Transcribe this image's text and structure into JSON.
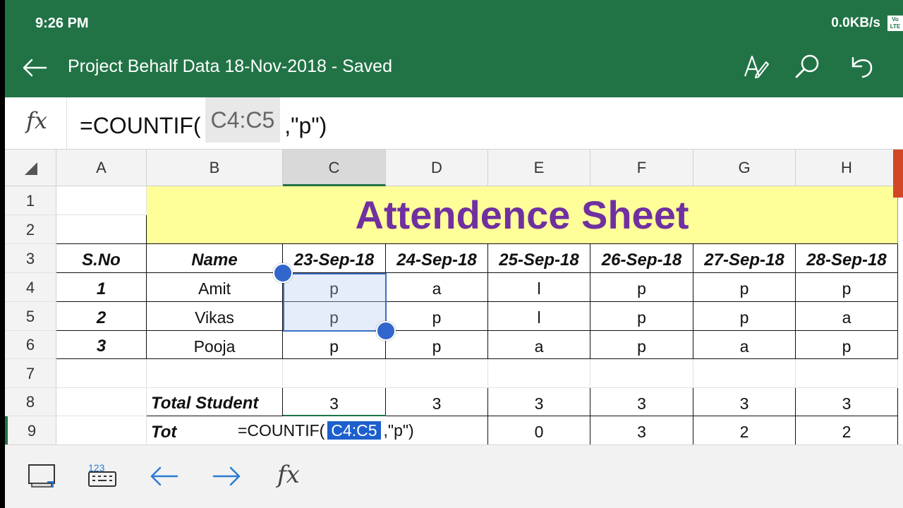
{
  "status": {
    "time": "9:26 PM",
    "network": "0.0KB/s",
    "lte_badge": "Vo LTE"
  },
  "titlebar": {
    "title": "Project Behalf Data 18-Nov-2018 - Saved"
  },
  "formula_bar": {
    "fx": "fx",
    "prefix": "=COUNTIF(",
    "ref": "C4:C5",
    "suffix": ",\"p\")"
  },
  "columns": [
    "A",
    "B",
    "C",
    "D",
    "E",
    "F",
    "G",
    "H"
  ],
  "rows": [
    "1",
    "2",
    "3",
    "4",
    "5",
    "6",
    "7",
    "8",
    "9"
  ],
  "sheet": {
    "banner": "Attendence Sheet",
    "headers": [
      "S.No",
      "Name",
      "23-Sep-18",
      "24-Sep-18",
      "25-Sep-18",
      "26-Sep-18",
      "27-Sep-18",
      "28-Sep-18"
    ],
    "records": [
      [
        "1",
        "Amit",
        "p",
        "a",
        "l",
        "p",
        "p",
        "p"
      ],
      [
        "2",
        "Vikas",
        "p",
        "p",
        "l",
        "p",
        "p",
        "a"
      ],
      [
        "3",
        "Pooja",
        "p",
        "p",
        "a",
        "p",
        "a",
        "p"
      ]
    ],
    "total_student": {
      "label": "Total Student",
      "values": [
        "3",
        "3",
        "3",
        "3",
        "3",
        "3"
      ]
    },
    "row9": {
      "label": "Tot",
      "values": [
        "0",
        "3",
        "2",
        "2"
      ]
    },
    "inline_editor": {
      "prefix": "=COUNTIF(",
      "ref": "C4:C5",
      "suffix": ",\"p\")"
    }
  },
  "colors": {
    "brand": "#217346",
    "banner_bg": "#ffff99",
    "banner_text": "#7030a0",
    "selection": "#3366cc"
  }
}
